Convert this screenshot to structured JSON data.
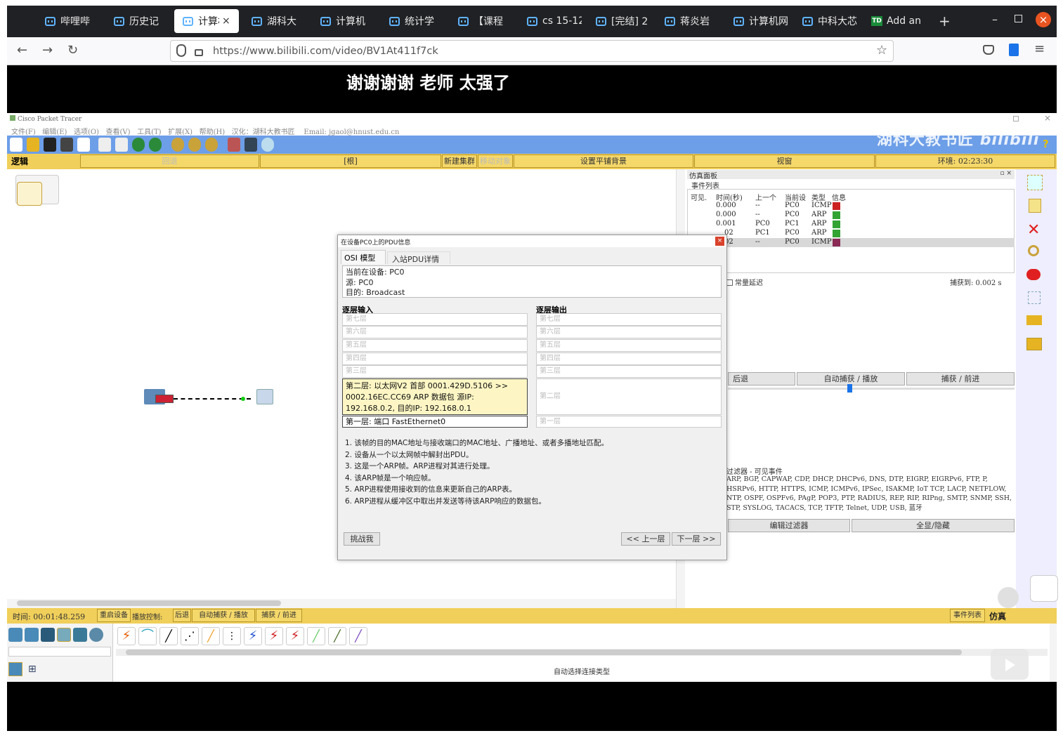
{
  "browser": {
    "tabs": [
      {
        "label": "哔哩哔哩"
      },
      {
        "label": "历史记录"
      },
      {
        "label": "计算机"
      },
      {
        "label": "湖科大教"
      },
      {
        "label": "计算机网"
      },
      {
        "label": "统计学习"
      },
      {
        "label": "【课程"
      },
      {
        "label": "cs 15-12"
      },
      {
        "label": "[完结] 2"
      },
      {
        "label": "蒋炎岩"
      },
      {
        "label": "计算机网"
      },
      {
        "label": "中科大芯"
      },
      {
        "label": "Add an"
      }
    ],
    "url": "https://www.bilibili.com/video/BV1At411f7ck",
    "icons": {
      "back": "back-arrow-icon",
      "forward": "forward-arrow-icon",
      "reload": "reload-icon"
    }
  },
  "video": {
    "subtitle": "谢谢谢谢 老师 太强了",
    "watermark": "湖科大教书匠"
  },
  "pt": {
    "title": "Cisco Packet Tracer",
    "menu": [
      "文件(F)",
      "编辑(E)",
      "选项(O)",
      "查看(V)",
      "工具(T)",
      "扩展(X)",
      "帮助(H)",
      "汉化：湖科大教书匠",
      "Email: jgaol@hnust.edu.cn"
    ],
    "row": {
      "logic": "逻辑",
      "back": "回退",
      "root": "[根]",
      "new_cluster": "新建集群",
      "move_object": "移动对象",
      "set_bg": "设置平铺背景",
      "viewport": "视窗",
      "env": "环境: 02:23:30"
    },
    "sim_panel": {
      "title": "仿真面板",
      "event_list": "事件列表",
      "headers": [
        "可见.",
        "时间(秒)",
        "上一个",
        "当前设",
        "类型",
        "信息"
      ],
      "events": [
        {
          "time": "0.000",
          "prev": "--",
          "cur": "PC0",
          "type": "ICMP",
          "color": "#cc2222"
        },
        {
          "time": "0.000",
          "prev": "--",
          "cur": "PC0",
          "type": "ARP",
          "color": "#33a333"
        },
        {
          "time": "0.001",
          "prev": "PC0",
          "cur": "PC1",
          "type": "ARP",
          "color": "#33a333"
        },
        {
          "time": "02",
          "prev": "PC1",
          "cur": "PC0",
          "type": "ARP",
          "color": "#33a333"
        },
        {
          "time": "02",
          "prev": "--",
          "cur": "PC0",
          "type": "ICMP",
          "color": "#8a2a55"
        }
      ],
      "const_delay": "常量延迟",
      "captured": "捕获到: 0.002 s",
      "play_back": "后退",
      "play_auto": "自动捕获 / 播放",
      "play_fwd": "捕获 / 前进",
      "filter_title": "过滤器 - 可见事件",
      "filter_text": "ARP, BGP, CAPWAP, CDP, DHCP, DHCPv6, DNS, DTP, EIGRP, EIGRPv6, FTP, P, HSRPv6, HTTP, HTTPS, ICMP, ICMPv6, IPSec, ISAKMP, IoT TCP, LACP, NETFLOW, NTP, OSPF, OSPFv6, PAgP, POP3, PTP, RADIUS, REP, RIP, RIPng, SMTP, SNMP, SSH, STP, SYSLOG, TACACS, TCP, TFTP, Telnet, UDP, USB, 蓝牙",
      "edit_filter": "编辑过滤器",
      "show_hide": "全显/隐藏"
    },
    "bottom": {
      "time": "时间: 00:01:48.259",
      "restart": "重启设备",
      "play_ctrl": "播放控制:",
      "back": "后退",
      "auto": "自动捕获 / 播放",
      "fwd": "捕获 / 前进",
      "event_list": "事件列表",
      "sim": "仿真",
      "auto_conn": "自动选择连接类型"
    }
  },
  "dialog": {
    "title": "在设备PC0上的PDU信息",
    "tabs": [
      "OSI 模型",
      "入站PDU详情"
    ],
    "current_device": "当前在设备: PC0",
    "source": "源: PC0",
    "dest": "目的: Broadcast",
    "in_title": "逐层输入",
    "out_title": "逐层输出",
    "in_layers": [
      "第七层",
      "第六层",
      "第五层",
      "第四层",
      "第三层"
    ],
    "layer2_in": "第二层: 以太网V2 首部 0001.429D.5106 >> 0002.16EC.CC69 ARP 数据包 源IP: 192.168.0.2, 目的IP: 192.168.0.1",
    "layer1_in": "第一层: 端口 FastEthernet0",
    "out_layers": [
      "第七层",
      "第六层",
      "第五层",
      "第四层",
      "第三层"
    ],
    "layer2_out": "第二层",
    "layer1_out": "第一层",
    "notes": [
      "1. 该帧的目的MAC地址与接收端口的MAC地址、广播地址、或者多播地址匹配。",
      "2. 设备从一个以太网帧中解封出PDU。",
      "3. 这是一个ARP帧。ARP进程对其进行处理。",
      "4. 该ARP帧是一个响应帧。",
      "5. ARP进程使用接收到的信息来更新自己的ARP表。",
      "6. ARP进程从缓冲区中取出并发送等待该ARP响应的数据包。"
    ],
    "challenge": "挑战我",
    "prev": "<< 上一层",
    "next": "下一层 >>"
  }
}
